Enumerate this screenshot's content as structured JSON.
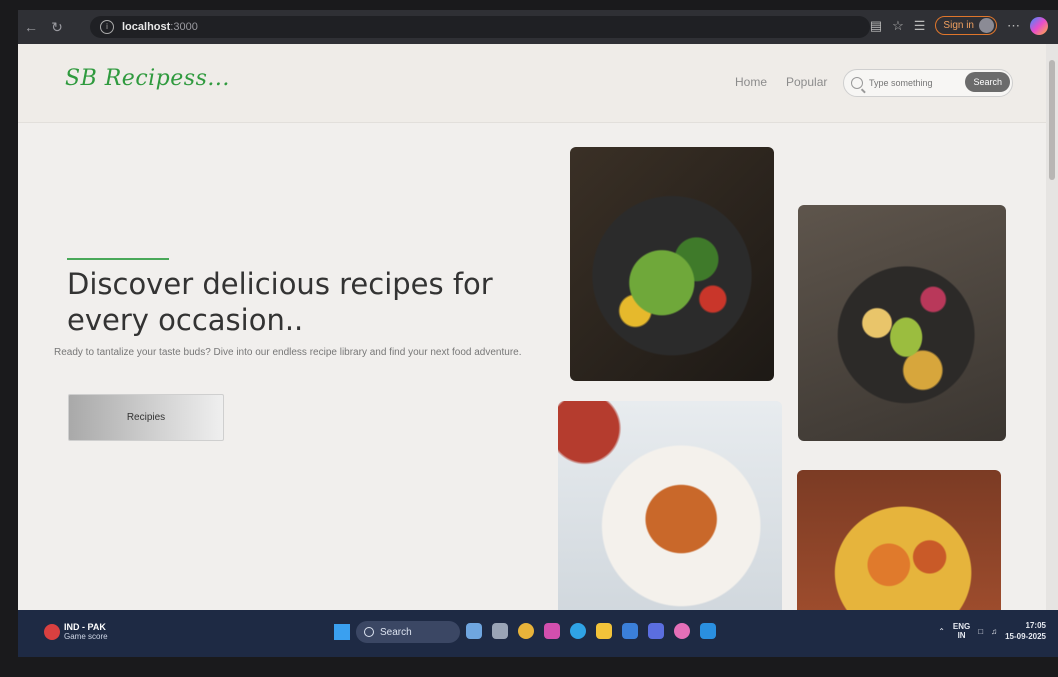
{
  "browser": {
    "url_host": "localhost",
    "url_port": ":3000",
    "signin_label": "Sign in"
  },
  "site": {
    "logo": "SB Recipess...",
    "nav": {
      "home": "Home",
      "popular": "Popular"
    },
    "search": {
      "placeholder": "Type something",
      "button": "Search"
    }
  },
  "hero": {
    "headline": "Discover delicious recipes for every occasion..",
    "subtext": "Ready to tantalize your taste buds? Dive into our endless recipe library and find your next food adventure.",
    "cta": "Recipies"
  },
  "taskbar": {
    "weather_title": "IND - PAK",
    "weather_sub": "Game score",
    "search_label": "Search",
    "lang_top": "ENG",
    "lang_bottom": "IN",
    "time": "17:05",
    "date": "15-09-2025"
  },
  "colors": {
    "accent": "#49a859",
    "taskbar": "#1e2a44"
  }
}
